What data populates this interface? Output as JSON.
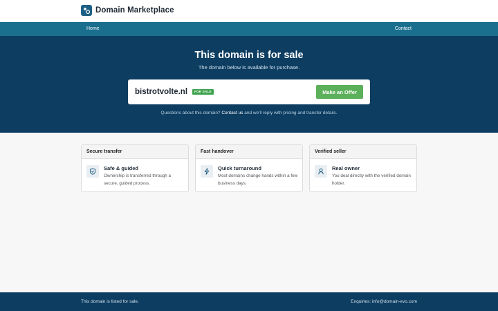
{
  "brand": {
    "name": "Domain Marketplace",
    "logo_icon": "domain-logo-icon"
  },
  "nav": {
    "home": "Home",
    "contact": "Contact"
  },
  "hero": {
    "title": "This domain is for sale",
    "subtitle": "The domain below is available for purchase.",
    "domain": "bistrotvolte.nl",
    "badge": "FOR SALE",
    "offer_button": "Make an Offer",
    "note_prefix": "Questions about this domain?",
    "note_link": "Contact us",
    "note_suffix": "and we'll reply with pricing and transfer details."
  },
  "features": [
    {
      "heading": "Secure transfer",
      "title": "Safe & guided",
      "desc": "Ownership is transferred through a secure, guided process.",
      "icon": "shield-check-icon"
    },
    {
      "heading": "Fast handover",
      "title": "Quick turnaround",
      "desc": "Most domains change hands within a few business days.",
      "icon": "lightning-icon"
    },
    {
      "heading": "Verified seller",
      "title": "Real owner",
      "desc": "You deal directly with the verified domain holder.",
      "icon": "user-icon"
    }
  ],
  "footer": {
    "left": "This domain is listed for sale.",
    "right": "Enquiries: info@domain-evo.com"
  },
  "colors": {
    "navy": "#0d3d61",
    "teal": "#1a6e8e",
    "accent_green": "#5cb05b",
    "badge_green": "#3fa34d"
  }
}
